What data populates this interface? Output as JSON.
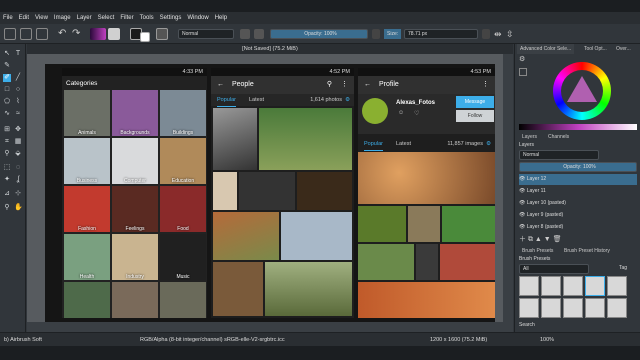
{
  "menu": [
    "File",
    "Edit",
    "View",
    "Image",
    "Layer",
    "Select",
    "Filter",
    "Tools",
    "Settings",
    "Window",
    "Help"
  ],
  "toolbar": {
    "blend_mode": "Normal",
    "opacity_label": "Opacity: 100%",
    "size_label": "Size:",
    "size_value": "78.71 px"
  },
  "document": {
    "tab_title": "[Not Saved]  (75.2 MiB)"
  },
  "screen1": {
    "time": "4:33 PM",
    "title": "Categories",
    "tiles": [
      {
        "label": "Animals",
        "color": "#6b6f66"
      },
      {
        "label": "Backgrounds",
        "color": "#8a5a9a"
      },
      {
        "label": "Buildings",
        "color": "#7c8a95"
      },
      {
        "label": "Business",
        "color": "#b9c3c9"
      },
      {
        "label": "Computer",
        "color": "#d9dadc"
      },
      {
        "label": "Education",
        "color": "#b08a5a"
      },
      {
        "label": "Fashion",
        "color": "#c23a2e"
      },
      {
        "label": "Feelings",
        "color": "#5a2a22"
      },
      {
        "label": "Food",
        "color": "#8a2a2a"
      },
      {
        "label": "Health",
        "color": "#7aa080"
      },
      {
        "label": "Industry",
        "color": "#c9b490"
      },
      {
        "label": "Music",
        "color": "#202020"
      },
      {
        "label": "",
        "color": "#4e6a4a"
      },
      {
        "label": "",
        "color": "#7a6a5a"
      },
      {
        "label": "",
        "color": "#6a6a5a"
      }
    ]
  },
  "screen2": {
    "time": "4:52 PM",
    "title": "People",
    "tab_popular": "Popular",
    "tab_latest": "Latest",
    "count": "1,614 photos"
  },
  "screen3": {
    "time": "4:53 PM",
    "title": "Profile",
    "username": "Alexas_Fotos",
    "message_btn": "Message",
    "follow_btn": "Follow",
    "tab_popular": "Popular",
    "tab_latest": "Latest",
    "count": "11,857 images"
  },
  "docker": {
    "tab1": "Advanced Color Sele...",
    "tab2": "Tool Opt...",
    "tab3": "Over...",
    "layers_tab": "Layers",
    "channels_tab": "Channels",
    "layers_header": "Layers",
    "layer_mode": "Normal",
    "layer_opacity": "Opacity: 100%",
    "layers": [
      "Layer 12",
      "Layer 11",
      "Layer 10 (pasted)",
      "Layer 9 (pasted)",
      "Layer 8 (pasted)"
    ],
    "brush_tab1": "Brush Presets",
    "brush_tab2": "Brush Preset History",
    "brush_header": "Brush Presets",
    "brush_filter": "All",
    "brush_tag": "Tag",
    "brush_search": "Search"
  },
  "status": {
    "brush": "b) Airbrush Soft",
    "color": "RGB/Alpha (8-bit integer/channel)  sRGB-elle-V2-srgbtrc.icc",
    "dims": "1200 x 1600 (75.2 MiB)",
    "zoom": "100%"
  },
  "colors": {
    "accent": "#3daee9",
    "panel": "#31363b",
    "message_btn": "#3daee9"
  }
}
